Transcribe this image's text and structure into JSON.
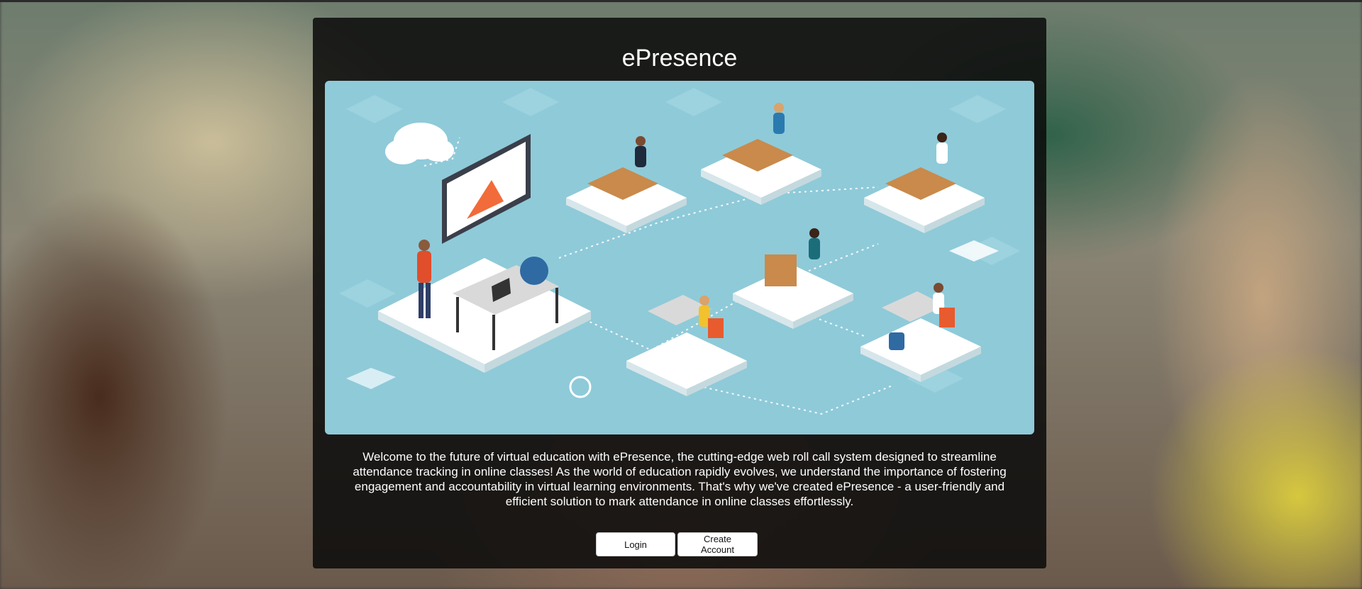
{
  "app": {
    "title": "ePresence"
  },
  "hero": {
    "image": "online-classroom-illustration",
    "background_color": "#8fcad9"
  },
  "description": "Welcome to the future of virtual education with ePresence, the cutting-edge web roll call system designed to streamline attendance tracking in online classes! As the world of education rapidly evolves, we understand the importance of fostering engagement and accountability in virtual learning environments. That's why we've created ePresence - a user-friendly and efficient solution to mark attendance in online classes effortlessly.",
  "actions": {
    "login_label": "Login",
    "create_account_label": "Create Account"
  },
  "colors": {
    "panel": "#0a0a0a",
    "button": "#ffffff",
    "accent_teal": "#8fcad9"
  }
}
